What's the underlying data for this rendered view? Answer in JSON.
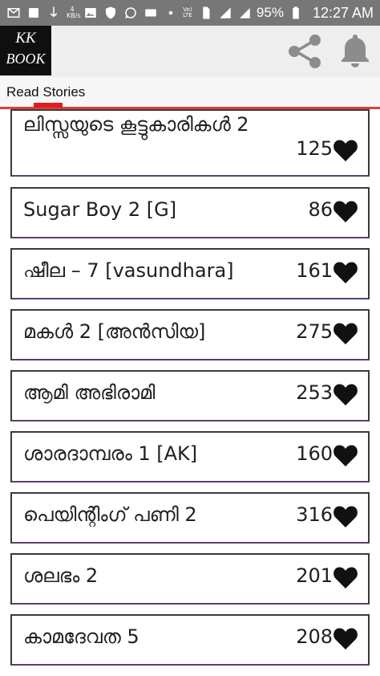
{
  "status_bar": {
    "network_speed": "4\nKB/s",
    "lte_label": "Vo)\nLTE",
    "battery": "95%",
    "time": "12:27 AM"
  },
  "app_bar": {
    "logo_line1": "KK",
    "logo_line2": "BOOK",
    "icon_color": "#8c8c8c"
  },
  "tabs": [
    {
      "label": "Read Stories",
      "active": true,
      "indicator_color": "#e31b1b"
    }
  ],
  "stories": [
    {
      "title": "ലിസ്സയുടെ കൂട്ടുകാരികൾ 2",
      "likes": "125"
    },
    {
      "title": "Sugar Boy 2 [G]",
      "likes": "86"
    },
    {
      "title": "ഷീല – 7 [vasundhara]",
      "likes": "161"
    },
    {
      "title": "മകൾ 2 [അൻസിയ]",
      "likes": "275"
    },
    {
      "title": "ആമി അഭിരാമി",
      "likes": "253"
    },
    {
      "title": "ശാരദാമ്പരം 1 [AK]",
      "likes": "160"
    },
    {
      "title": "പെയിന്റിംഗ് പണി 2",
      "likes": "316"
    },
    {
      "title": "ശലഭം 2",
      "likes": "201"
    },
    {
      "title": "കാമദേവത 5",
      "likes": "208"
    }
  ]
}
